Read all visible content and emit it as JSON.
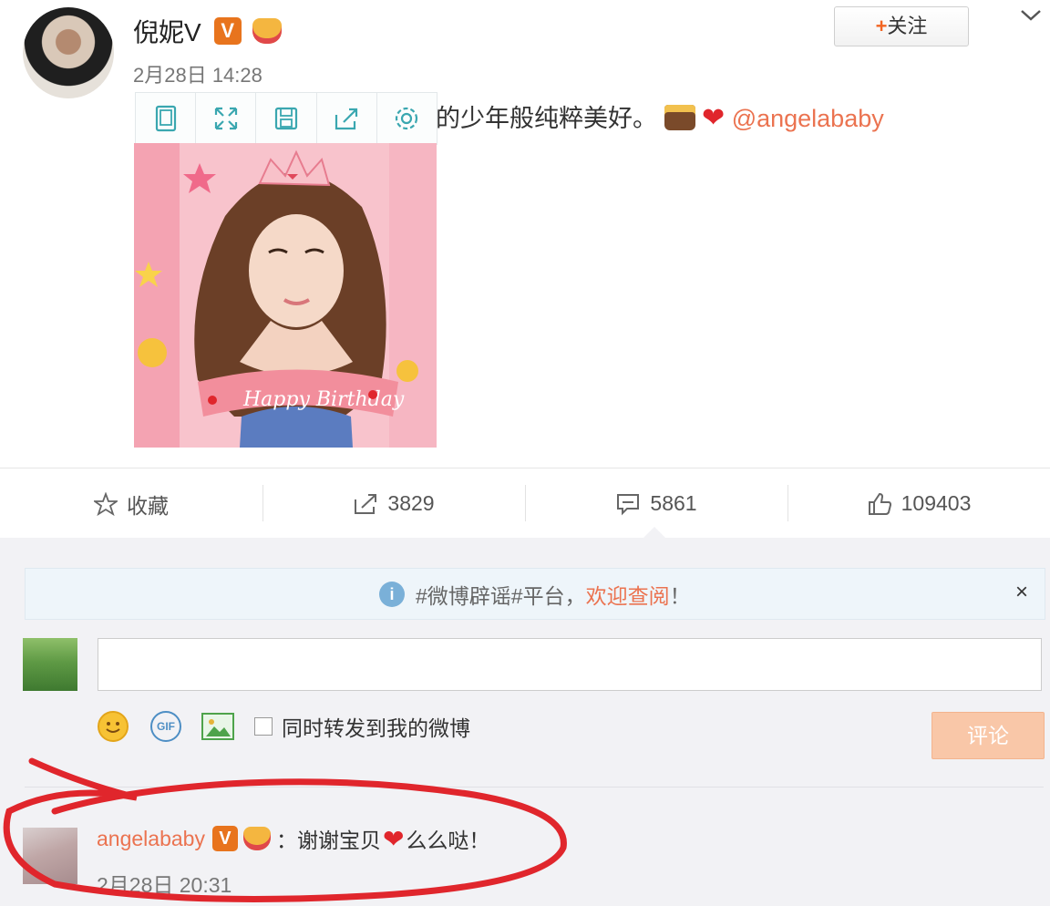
{
  "post": {
    "author": "倪妮V",
    "time": "2月28日 14:28",
    "follow_label": "关注",
    "follow_plus": "+",
    "text_before": "的少年般纯粹美好。",
    "mention": "@angelababy"
  },
  "image_toolbar": [
    "portrait-icon",
    "expand-icon",
    "save-icon",
    "share-icon",
    "settings-icon"
  ],
  "actions": {
    "favorite_label": "收藏",
    "repost_count": "3829",
    "comment_count": "5861",
    "like_count": "109403"
  },
  "notice": {
    "text_prefix": "#微博辟谣#平台，",
    "link_text": "欢迎查阅",
    "suffix": "！",
    "close": "×"
  },
  "composer": {
    "checkbox_label": "同时转发到我的微博",
    "submit_label": "评论",
    "gif_label": "GIF"
  },
  "reply": {
    "user": "angelababy",
    "text_before_heart": "：谢谢宝贝",
    "text_after_heart": "么么哒！",
    "time": "2月28日 20:31"
  },
  "badges": {
    "v_label": "V"
  },
  "colors": {
    "accent": "#eb7350",
    "vip": "#e8741d",
    "annotation": "#e0262c"
  }
}
